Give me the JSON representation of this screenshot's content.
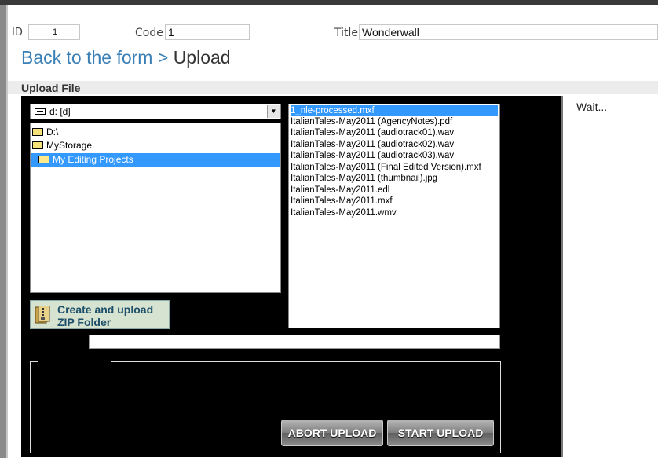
{
  "form": {
    "id_label": "ID",
    "id_value": "1",
    "code_label": "Code",
    "code_value": "1",
    "title_label": "Title",
    "title_value": "Wonderwall"
  },
  "heading": {
    "back_link": "Back to the form",
    "separator": ">",
    "current": "Upload"
  },
  "section": {
    "title": "Upload File"
  },
  "status": {
    "text": "Wait..."
  },
  "drive": {
    "value": "d: [d]",
    "dropdown_icon": "chevron-down-icon"
  },
  "tree": [
    {
      "label": "D:\\",
      "selected": false
    },
    {
      "label": "MyStorage",
      "selected": false
    },
    {
      "label": "My Editing Projects",
      "selected": true
    }
  ],
  "files": [
    {
      "name": "1_nle-processed.mxf",
      "selected": true
    },
    {
      "name": "ItalianTales-May2011 (AgencyNotes).pdf",
      "selected": false
    },
    {
      "name": "ItalianTales-May2011 (audiotrack01).wav",
      "selected": false
    },
    {
      "name": "ItalianTales-May2011 (audiotrack02).wav",
      "selected": false
    },
    {
      "name": "ItalianTales-May2011 (audiotrack03).wav",
      "selected": false
    },
    {
      "name": "ItalianTales-May2011 (Final Edited Version).mxf",
      "selected": false
    },
    {
      "name": "ItalianTales-May2011 (thumbnail).jpg",
      "selected": false
    },
    {
      "name": "ItalianTales-May2011.edl",
      "selected": false
    },
    {
      "name": "ItalianTales-May2011.mxf",
      "selected": false
    },
    {
      "name": "ItalianTales-May2011.wmv",
      "selected": false
    }
  ],
  "zip_button": {
    "line1": "Create and upload",
    "line2": "ZIP Folder",
    "icon": "zip-archive-icon"
  },
  "buttons": {
    "abort": "ABORT UPLOAD",
    "start": "START UPLOAD"
  },
  "colors": {
    "link": "#3a7fb5",
    "selection": "#3399ff",
    "applet_bg": "#000000"
  }
}
